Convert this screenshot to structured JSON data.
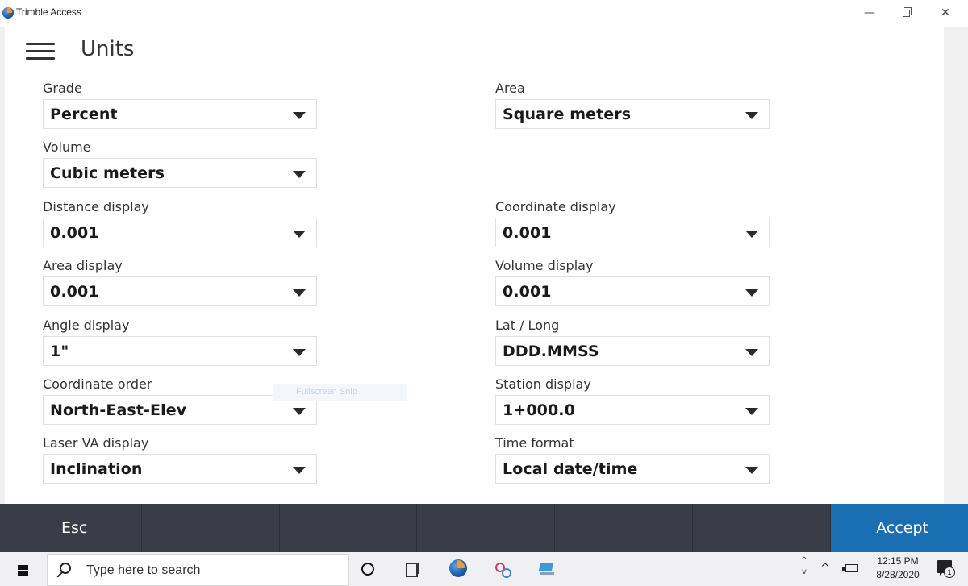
{
  "window": {
    "title": "Trimble Access",
    "minimize_glyph": "—",
    "close_glyph": "✕"
  },
  "page": {
    "title": "Units"
  },
  "fields": {
    "grade": {
      "label": "Grade",
      "value": "Percent"
    },
    "area": {
      "label": "Area",
      "value": "Square meters"
    },
    "volume": {
      "label": "Volume",
      "value": "Cubic meters"
    },
    "distance_display": {
      "label": "Distance display",
      "value": "0.001"
    },
    "coordinate_display": {
      "label": "Coordinate display",
      "value": "0.001"
    },
    "area_display": {
      "label": "Area display",
      "value": "0.001"
    },
    "volume_display": {
      "label": "Volume display",
      "value": "0.001"
    },
    "angle_display": {
      "label": "Angle display",
      "value": "1\""
    },
    "lat_long": {
      "label": "Lat / Long",
      "value": "DDD.MMSS"
    },
    "coordinate_order": {
      "label": "Coordinate order",
      "value": "North-East-Elev"
    },
    "station_display": {
      "label": "Station display",
      "value": "1+000.0"
    },
    "laser_va_display": {
      "label": "Laser VA display",
      "value": "Inclination"
    },
    "time_format": {
      "label": "Time format",
      "value": "Local date/time"
    }
  },
  "overlay": {
    "snip_tooltip": "Fullscreen Snip"
  },
  "softkeys": {
    "esc": "Esc",
    "accept": "Accept"
  },
  "taskbar": {
    "search_placeholder": "Type here to search",
    "clock_time": "12:15 PM",
    "clock_date": "8/28/2020",
    "notification_count": "1",
    "scroll_up": "^",
    "scroll_down": "v",
    "tray_chevron": "^"
  }
}
